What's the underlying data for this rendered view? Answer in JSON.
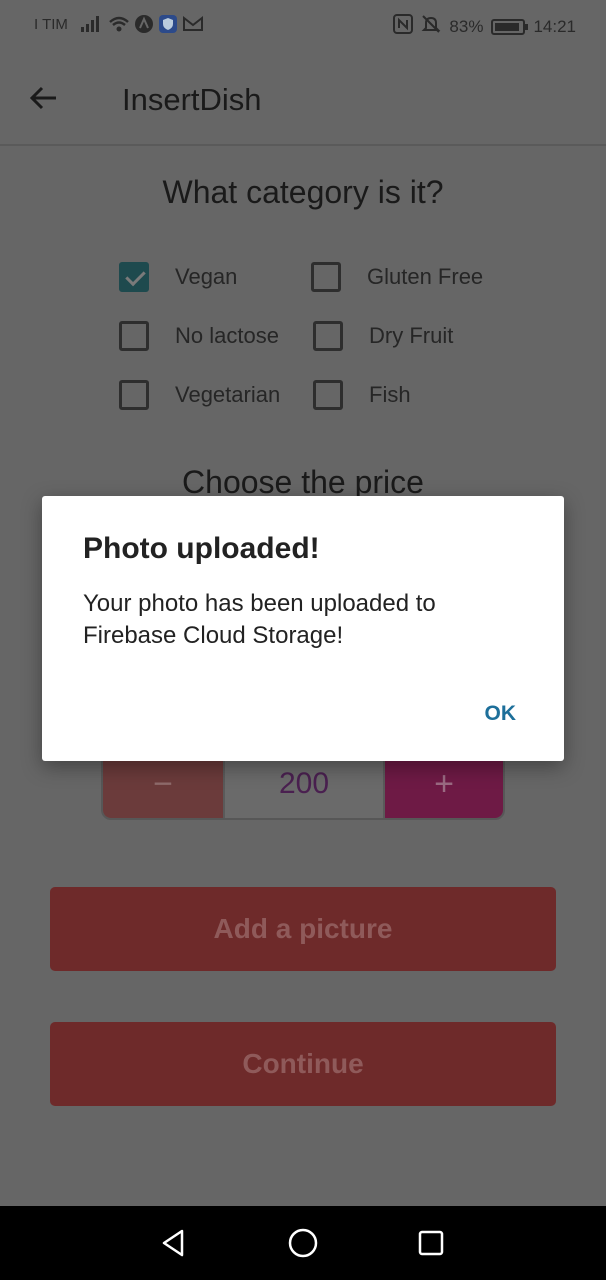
{
  "status_bar": {
    "carrier": "I TIM",
    "battery": "83%",
    "time": "14:21"
  },
  "app_bar": {
    "title": "InsertDish"
  },
  "category": {
    "title": "What category is it?",
    "options": [
      {
        "label": "Vegan",
        "checked": true
      },
      {
        "label": "Gluten Free",
        "checked": false
      },
      {
        "label": "No lactose",
        "checked": false
      },
      {
        "label": "Dry Fruit",
        "checked": false
      },
      {
        "label": "Vegetarian",
        "checked": false
      },
      {
        "label": "Fish",
        "checked": false
      }
    ]
  },
  "price": {
    "title": "Choose the price",
    "minus_label": "−",
    "value": "200",
    "plus_label": "+"
  },
  "buttons": {
    "add_picture": "Add a picture",
    "continue": "Continue"
  },
  "dialog": {
    "title": "Photo uploaded!",
    "message": "Your photo has been uploaded to Firebase Cloud Storage!",
    "ok": "OK"
  },
  "colors": {
    "accent": "#1d6f9a",
    "checkbox_checked": "#1e4a4e"
  }
}
